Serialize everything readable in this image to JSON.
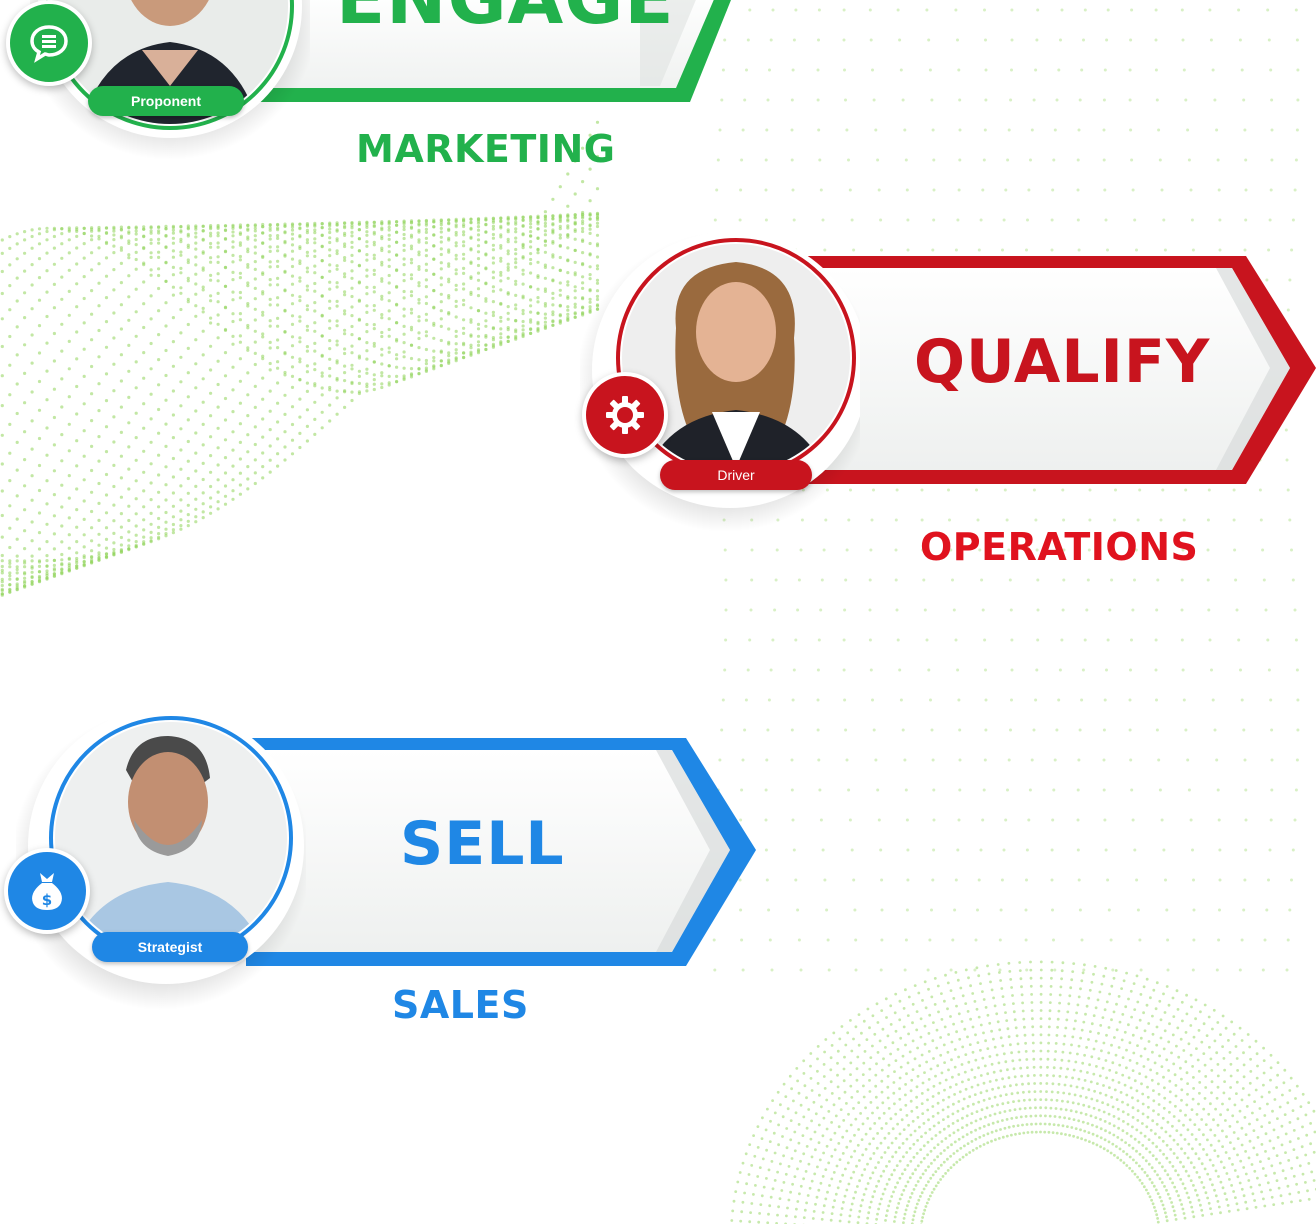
{
  "colors": {
    "green": "#22b14c",
    "red": "#c8141e",
    "blue": "#1f87e5",
    "dots": "#8fd35a"
  },
  "cards": [
    {
      "id": "engage",
      "word": "ENGAGE",
      "department": "MARKETING",
      "role": "Proponent",
      "icon": "chat-bubble-icon",
      "color": "#22b14c"
    },
    {
      "id": "qualify",
      "word": "QUALIFY",
      "department": "OPERATIONS",
      "role": "Driver",
      "icon": "gear-icon",
      "color": "#c8141e"
    },
    {
      "id": "sell",
      "word": "SELL",
      "department": "SALES",
      "role": "Strategist",
      "icon": "money-bag-icon",
      "color": "#1f87e5"
    }
  ]
}
